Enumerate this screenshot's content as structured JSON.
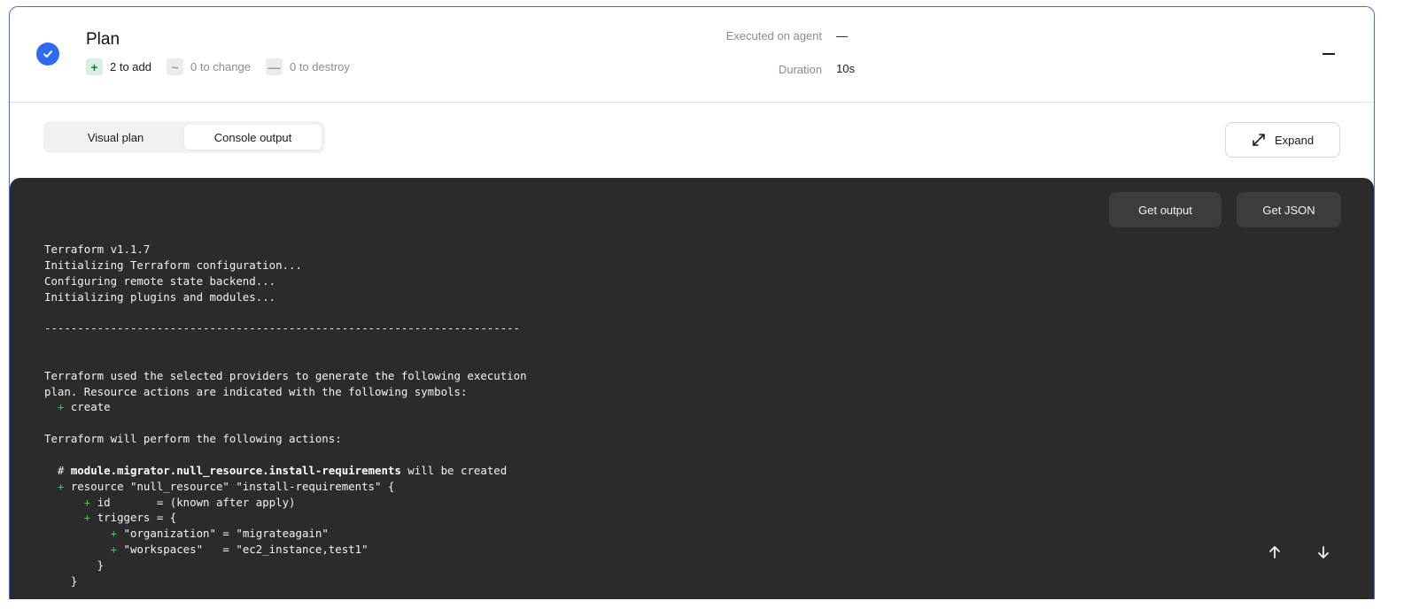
{
  "run": {
    "title": "Plan",
    "summary": {
      "add": {
        "symbol": "+",
        "label": "2 to add"
      },
      "change": {
        "symbol": "~",
        "label": "0 to change"
      },
      "destroy": {
        "symbol": "—",
        "label": "0 to destroy"
      }
    },
    "executed_on_agent_label": "Executed on agent",
    "executed_on_agent_value": "—",
    "duration_label": "Duration",
    "duration_value": "10s"
  },
  "tabs": [
    {
      "label": "Visual plan",
      "active": false
    },
    {
      "label": "Console output",
      "active": true
    }
  ],
  "expand_label": "Expand",
  "console": {
    "get_output_label": "Get output",
    "get_json_label": "Get JSON",
    "lines": [
      [
        {
          "t": "Terraform v1.1.7"
        }
      ],
      [
        {
          "t": "Initializing Terraform configuration..."
        }
      ],
      [
        {
          "t": "Configuring remote state backend..."
        }
      ],
      [
        {
          "t": "Initializing plugins and modules..."
        }
      ],
      [
        {
          "t": ""
        }
      ],
      [
        {
          "t": "------------------------------------------------------------------------"
        }
      ],
      [
        {
          "t": ""
        }
      ],
      [
        {
          "t": ""
        }
      ],
      [
        {
          "t": "Terraform used the selected providers to generate the following execution"
        }
      ],
      [
        {
          "t": "plan. Resource actions are indicated with the following symbols:"
        }
      ],
      [
        {
          "t": "  "
        },
        {
          "t": "+",
          "c": "plus"
        },
        {
          "t": " create"
        }
      ],
      [
        {
          "t": ""
        }
      ],
      [
        {
          "t": "Terraform will perform the following actions:"
        }
      ],
      [
        {
          "t": ""
        }
      ],
      [
        {
          "t": "  # "
        },
        {
          "t": "module.migrator.null_resource.install-requirements",
          "c": "bold"
        },
        {
          "t": " will be created"
        }
      ],
      [
        {
          "t": "  "
        },
        {
          "t": "+",
          "c": "plus"
        },
        {
          "t": " resource \"null_resource\" \"install-requirements\" {"
        }
      ],
      [
        {
          "t": "      "
        },
        {
          "t": "+",
          "c": "plus"
        },
        {
          "t": " id       = (known after apply)"
        }
      ],
      [
        {
          "t": "      "
        },
        {
          "t": "+",
          "c": "plus"
        },
        {
          "t": " triggers = {"
        }
      ],
      [
        {
          "t": "          "
        },
        {
          "t": "+",
          "c": "plus"
        },
        {
          "t": " \"organization\" = \"migrateagain\""
        }
      ],
      [
        {
          "t": "          "
        },
        {
          "t": "+",
          "c": "plus"
        },
        {
          "t": " \"workspaces\"   = \"ec2_instance,test1\""
        }
      ],
      [
        {
          "t": "        }"
        }
      ],
      [
        {
          "t": "    }"
        }
      ]
    ]
  }
}
